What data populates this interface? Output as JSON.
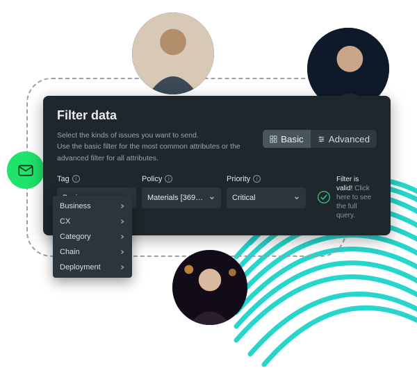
{
  "panel": {
    "title": "Filter data",
    "subhead_l1": "Select the kinds of issues you want to send.",
    "subhead_l2": "Use the basic filter for the most common attributes or the advanced filter for all attributes."
  },
  "mode": {
    "basic": "Basic",
    "advanced": "Advanced",
    "active": "basic"
  },
  "fields": {
    "tag": {
      "label": "Tag",
      "value": "Business"
    },
    "policy": {
      "label": "Policy",
      "value": "Materials [369…"
    },
    "priority": {
      "label": "Priority",
      "value": "Critical"
    }
  },
  "tag_options": [
    "Business",
    "CX",
    "Category",
    "Chain",
    "Deployment"
  ],
  "validity": {
    "lead": "Filter is valid!",
    "hint": "Click here to see the full query."
  },
  "icons": {
    "mail": "mail-icon",
    "basic": "grid-icon",
    "advanced": "sliders-icon",
    "check": "check-circle-icon"
  },
  "colors": {
    "panel_bg": "#1f272c",
    "select_bg": "#2c353b",
    "accent_green": "#1fe36a",
    "accent_teal": "#1ad3c9",
    "check_ring": "#2dc87a"
  },
  "avatars": [
    "person-1",
    "person-2",
    "person-3"
  ]
}
